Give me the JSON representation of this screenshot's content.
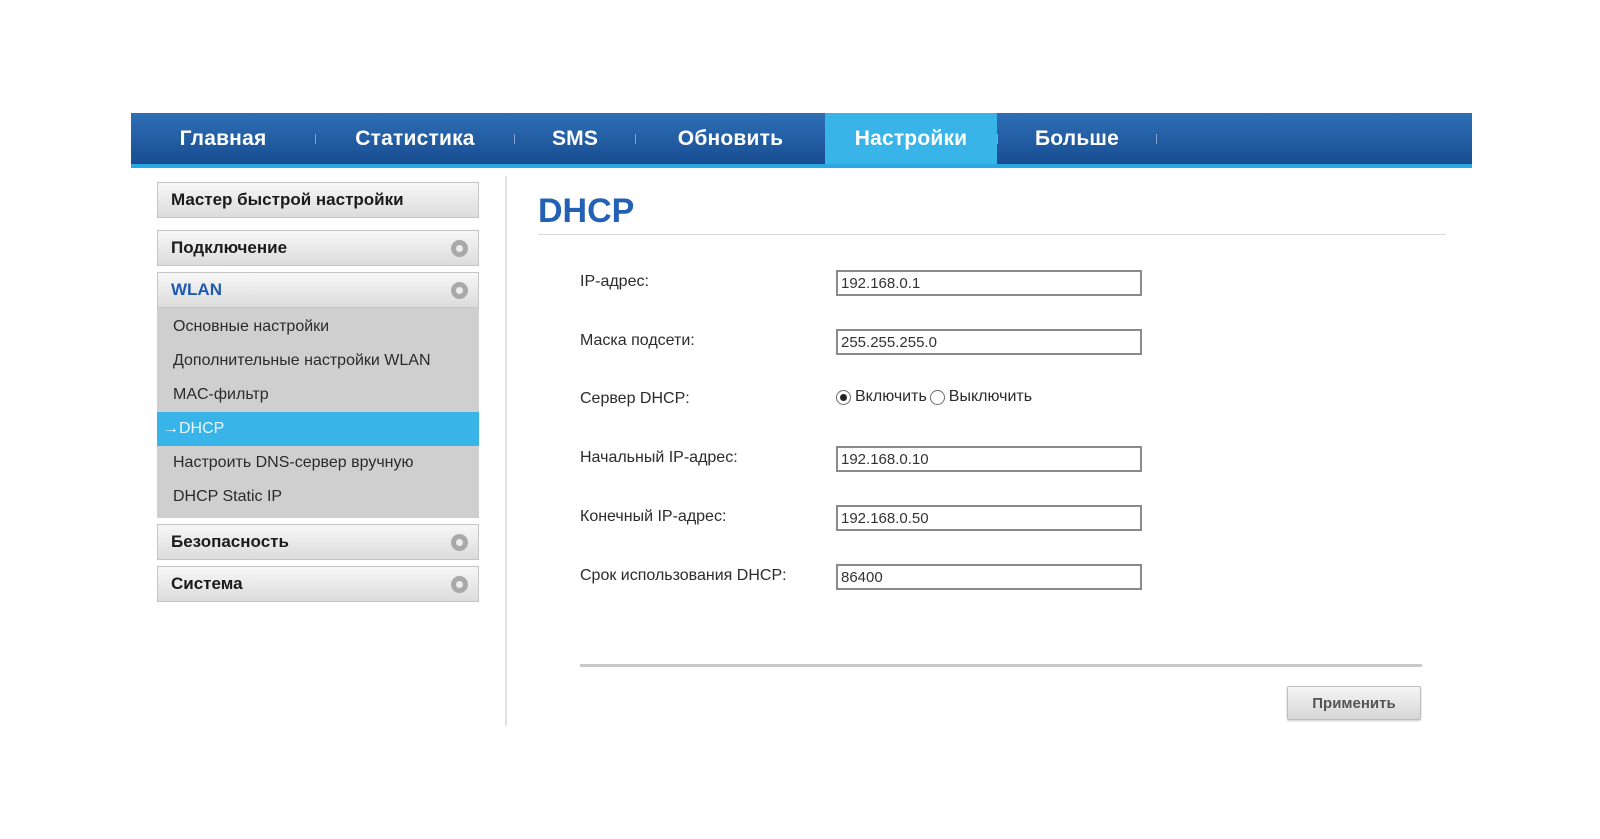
{
  "nav": {
    "tabs": [
      {
        "label": "Главная"
      },
      {
        "label": "Статистика"
      },
      {
        "label": "SMS"
      },
      {
        "label": "Обновить"
      },
      {
        "label": "Настройки",
        "active": true
      },
      {
        "label": "Больше"
      }
    ]
  },
  "sidebar": {
    "quick_setup": "Мастер быстрой настройки",
    "connection": "Подключение",
    "wlan": "WLAN",
    "wlan_items": [
      "Основные настройки",
      "Дополнительные настройки WLAN",
      "MAC-фильтр",
      "DHCP",
      "Настроить DNS-сервер вручную",
      "DHCP Static IP"
    ],
    "active_item_marker": "→",
    "security": "Безопасность",
    "system": "Система"
  },
  "main": {
    "title": "DHCP",
    "fields": {
      "ip_label": "IP-адрес:",
      "ip_value": "192.168.0.1",
      "mask_label": "Маска подсети:",
      "mask_value": "255.255.255.0",
      "server_label": "Сервер DHCP:",
      "enable_label": "Включить",
      "disable_label": "Выключить",
      "server_enabled": true,
      "start_label": "Начальный IP-адрес:",
      "start_value": "192.168.0.10",
      "end_label": "Конечный IP-адрес:",
      "end_value": "192.168.0.50",
      "lease_label": "Срок использования DHCP:",
      "lease_value": "86400"
    },
    "apply_label": "Применить"
  },
  "colors": {
    "nav_blue": "#1f5aa3",
    "nav_active": "#39b4e8",
    "title_blue": "#2361b4"
  }
}
